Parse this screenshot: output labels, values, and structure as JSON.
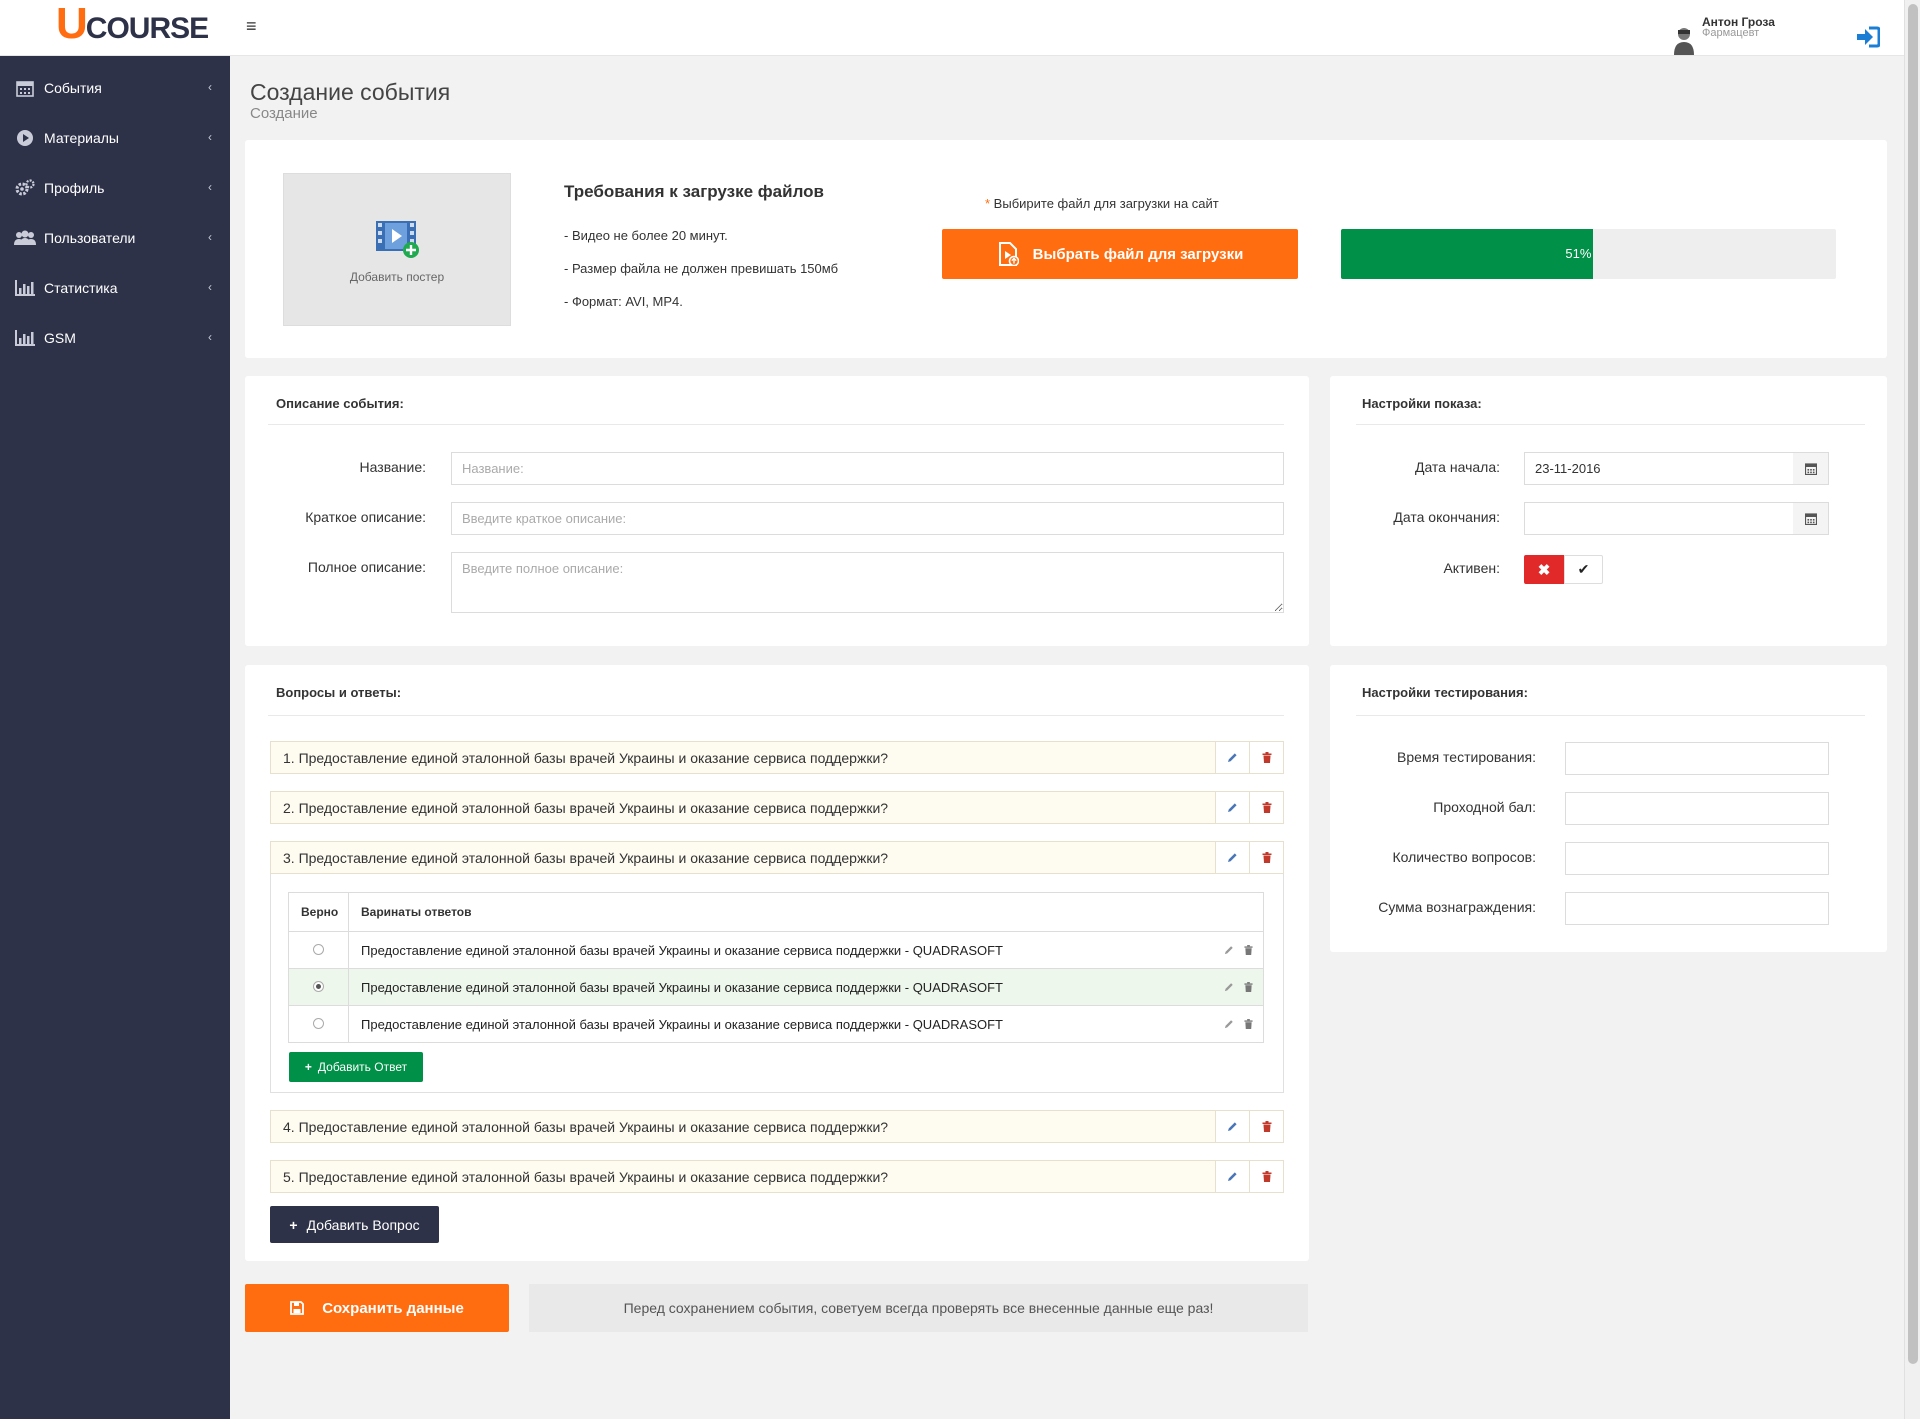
{
  "header": {
    "logo_first": "U",
    "logo_rest": "COURSE",
    "menu_icon": "hamburger-icon",
    "user_name": "Антон Гроза",
    "user_role": "Фармацевт",
    "logout_icon": "sign-in-icon"
  },
  "sidebar": {
    "items": [
      {
        "label": "События",
        "icon": "calendar-icon"
      },
      {
        "label": "Материалы",
        "icon": "play-circle-icon"
      },
      {
        "label": "Профиль",
        "icon": "gears-icon"
      },
      {
        "label": "Пользователи",
        "icon": "users-icon"
      },
      {
        "label": "Статистика",
        "icon": "bar-chart-icon"
      },
      {
        "label": "GSM",
        "icon": "bar-chart-icon"
      }
    ],
    "chevron": "‹"
  },
  "page": {
    "title": "Создание события",
    "subtitle": "Создание"
  },
  "upload": {
    "poster_label": "Добавить постер",
    "requirements_title": "Требования к загрузке файлов",
    "requirements": [
      "- Видео не более 20 минут.",
      "- Размер файла не должен превишать 150мб",
      "- Формат: AVI, MP4."
    ],
    "choose_hint_star": "*",
    "choose_hint": " Выбирите файл для загрузки на сайт",
    "choose_button": "Выбрать файл для загрузки",
    "progress_value": 51,
    "progress_label": "51%"
  },
  "description": {
    "heading": "Описание события:",
    "name_label": "Название:",
    "name_placeholder": "Название:",
    "short_label": "Краткое описание:",
    "short_placeholder": "Введите краткое описание:",
    "full_label": "Полное описание:",
    "full_placeholder": "Введите полное описание:"
  },
  "display_settings": {
    "heading": "Настройки показа:",
    "start_label": "Дата начала:",
    "start_value": "23-11-2016",
    "end_label": "Дата окончания:",
    "end_value": "",
    "active_label": "Активен:",
    "active_no": "✖",
    "active_yes": "✔"
  },
  "questions": {
    "heading": "Вопросы и ответы:",
    "items": [
      "1. Предоставление единой эталонной базы врачей Украины и оказание сервиса поддержки?",
      "2. Предоставление единой эталонной базы врачей Украины и оказание сервиса поддержки?",
      "3. Предоставление единой эталонной базы врачей Украины и оказание сервиса поддержки?",
      "4. Предоставление единой эталонной базы врачей Украины и оказание сервиса поддержки?",
      "5. Предоставление единой эталонной базы врачей Украины и оказание сервиса поддержки?"
    ],
    "answers_table": {
      "col_correct": "Верно",
      "col_answers": "Варинаты ответов",
      "rows": [
        {
          "text": "Предоставление единой эталонной базы врачей Украины и оказание сервиса поддержки - QUADRASOFT",
          "correct": false
        },
        {
          "text": "Предоставление единой эталонной базы врачей Украины и оказание сервиса поддержки - QUADRASOFT",
          "correct": true
        },
        {
          "text": "Предоставление единой эталонной базы врачей Украины и оказание сервиса поддержки - QUADRASOFT",
          "correct": false
        }
      ]
    },
    "add_answer": "Добавить Ответ",
    "add_question": "Добавить Вопрос"
  },
  "test_settings": {
    "heading": "Настройки тестирования:",
    "time_label": "Время тестирования:",
    "pass_label": "Проходной бал:",
    "count_label": "Количество вопросов:",
    "reward_label": "Сумма вознаграждения:"
  },
  "footer": {
    "save_button": "Сохранить данные",
    "save_note": "Перед сохранением события, советуем всегда проверять все внесенные данные еще раз!"
  },
  "colors": {
    "sidebar": "#2e3248",
    "accent": "#ff6d10",
    "success": "#009047",
    "danger": "#e1292a"
  }
}
